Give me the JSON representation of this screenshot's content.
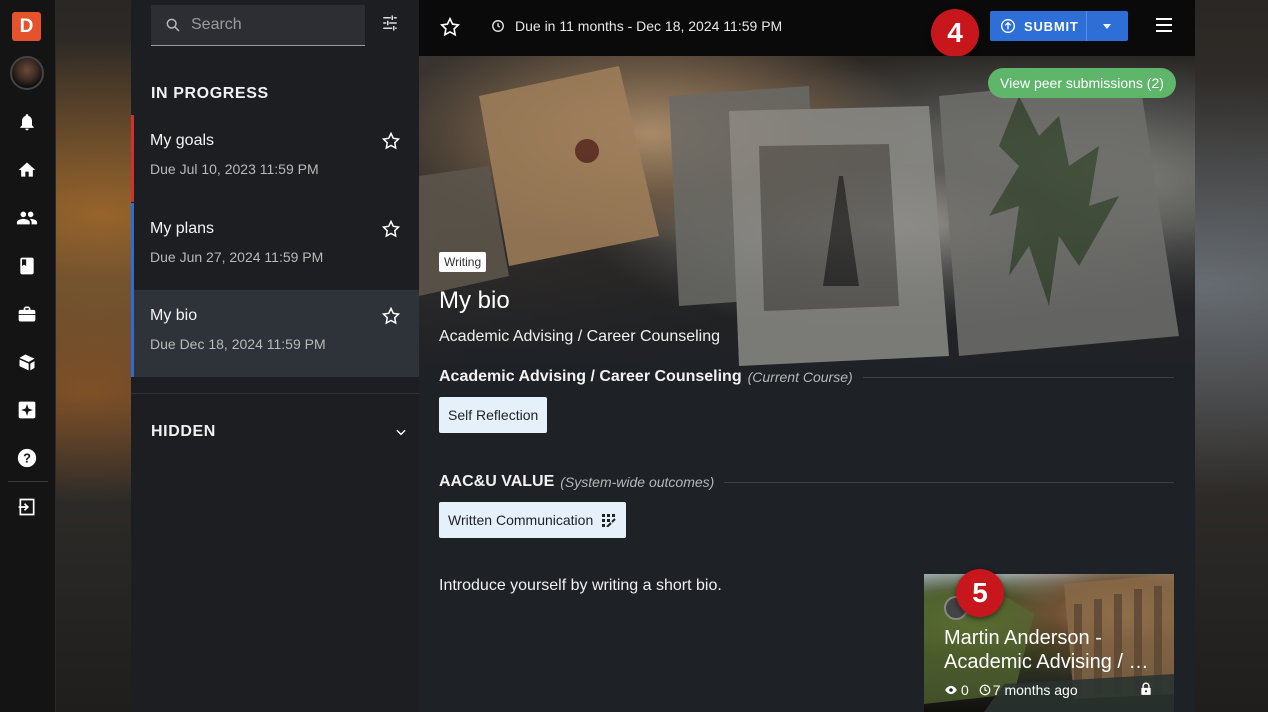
{
  "rail": {
    "logo_letter": "D",
    "items": [
      "bell-icon",
      "home-icon",
      "people-icon",
      "book-icon",
      "briefcase-icon",
      "outcomes-icon",
      "sparkle-badge-icon",
      "help-icon",
      "logout-icon"
    ]
  },
  "sidebar": {
    "search_placeholder": "Search",
    "in_progress_title": "IN PROGRESS",
    "items": [
      {
        "title": "My goals",
        "due": "Due Jul 10, 2023 11:59 PM",
        "accent": "#d0312d"
      },
      {
        "title": "My plans",
        "due": "Due Jun 27, 2024 11:59 PM",
        "accent": "#2e6cd1"
      },
      {
        "title": "My bio",
        "due": "Due Dec 18, 2024 11:59 PM",
        "accent": "#2e6cd1"
      }
    ],
    "hidden_title": "HIDDEN"
  },
  "topbar": {
    "due_text": "Due in 11 months - Dec 18, 2024 11:59 PM",
    "submit_label": "SUBMIT",
    "callout_4": "4"
  },
  "hero": {
    "peer_label": "View peer submissions (2)",
    "tag": "Writing",
    "title": "My bio",
    "subtitle": "Academic Advising / Career Counseling"
  },
  "course": {
    "name": "Academic Advising / Career Counseling",
    "note": "(Current Course)",
    "chip": "Self Reflection"
  },
  "value": {
    "name": "AAC&U VALUE",
    "note": "(System-wide outcomes)",
    "chip": "Written Communication"
  },
  "prompt": "Introduce yourself by writing a short bio.",
  "peer_card": {
    "callout_5": "5",
    "title": "Martin Anderson - Academic Advising / …",
    "views": "0",
    "time": "7 months ago"
  },
  "colors": {
    "accent_blue": "#2d6fd6",
    "peer_green": "#5fb56a",
    "callout_red": "#c8161d",
    "logo_orange": "#e5532d"
  }
}
